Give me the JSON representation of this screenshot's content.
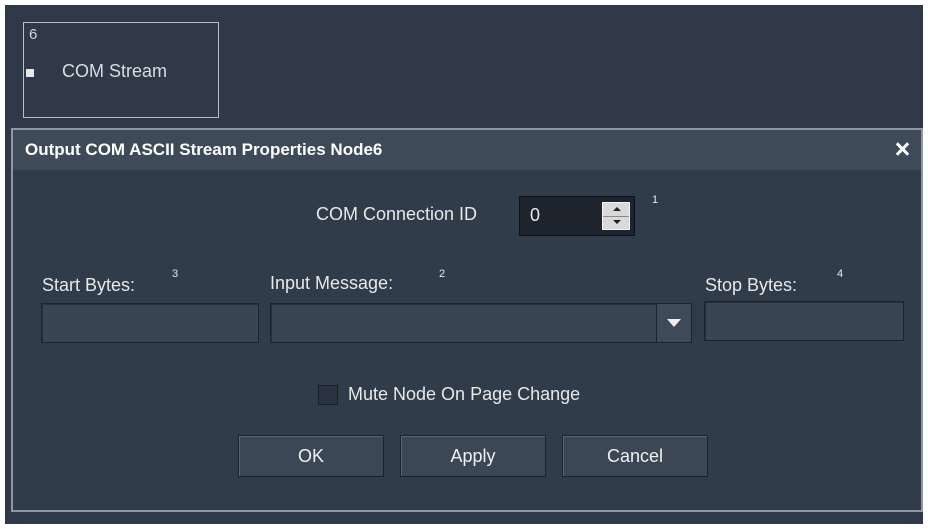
{
  "node": {
    "id": "6",
    "title": "COM Stream"
  },
  "dialog": {
    "title": "Output COM ASCII Stream Properties Node6",
    "close_icon": "close-icon",
    "com_connection": {
      "label": "COM Connection ID",
      "value": "0",
      "superscript": "1"
    },
    "start_bytes": {
      "label": "Start Bytes:",
      "superscript": "3",
      "value": ""
    },
    "input_message": {
      "label": "Input Message:",
      "superscript": "2",
      "value": ""
    },
    "stop_bytes": {
      "label": "Stop Bytes:",
      "superscript": "4",
      "value": ""
    },
    "mute_checkbox": {
      "label": "Mute Node On Page Change",
      "checked": false
    },
    "buttons": {
      "ok": "OK",
      "apply": "Apply",
      "cancel": "Cancel"
    }
  }
}
